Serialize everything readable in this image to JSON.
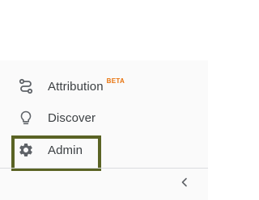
{
  "nav": {
    "items": [
      {
        "label": "Attribution",
        "badge": "BETA",
        "icon": "attribution-path-icon"
      },
      {
        "label": "Discover",
        "icon": "lightbulb-icon"
      },
      {
        "label": "Admin",
        "icon": "gear-icon",
        "highlighted": true
      }
    ]
  },
  "collapse_icon": "chevron-left-icon",
  "colors": {
    "text": "#3c4043",
    "icon": "#5f6368",
    "badge": "#e8710a",
    "highlight_border": "#5a6324",
    "sidebar_bg": "#fafafa",
    "divider": "#dadce0"
  }
}
